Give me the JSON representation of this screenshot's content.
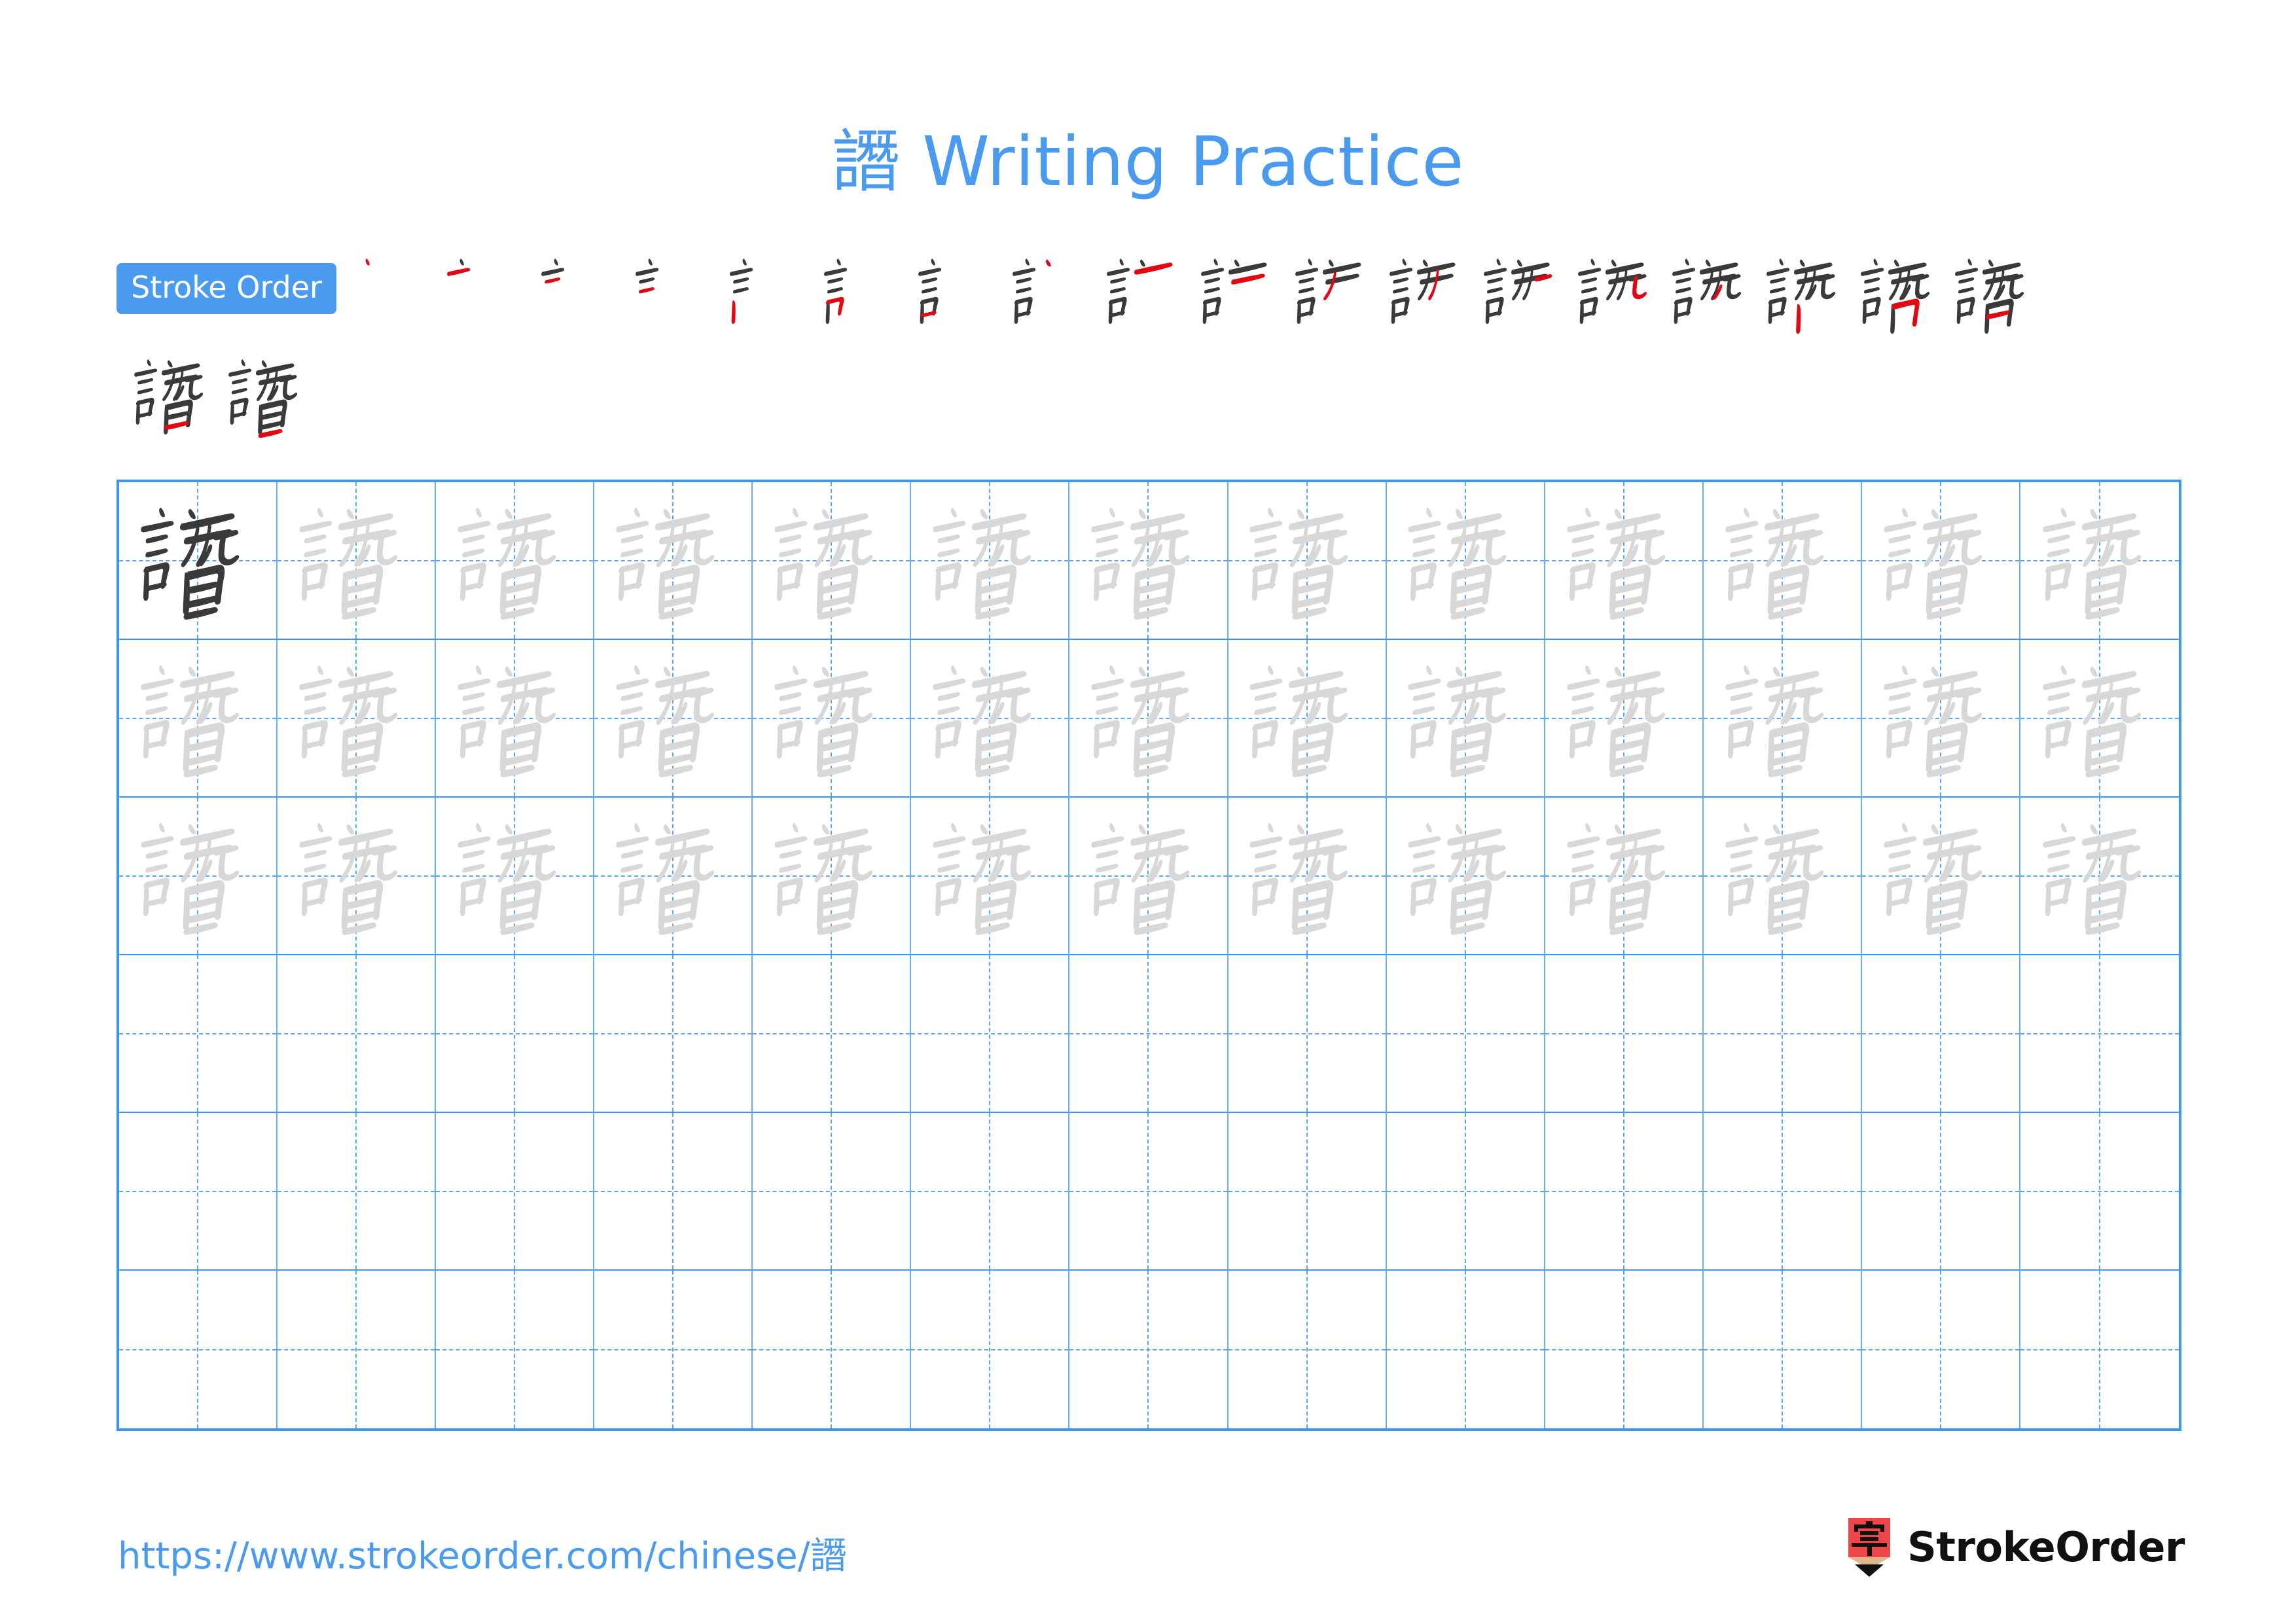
{
  "page": {
    "character": "譖",
    "title_suffix": " Writing Practice",
    "title_full": "譖 Writing Practice",
    "background_color": "#ffffff",
    "accent_color": "#4A9BF0",
    "grid_line_color": "#3E95F0",
    "guide_line_color": "#5AA6F5",
    "faint_glyph_color": "#D8D8D8",
    "dark_glyph_color": "#3A3A3A",
    "highlight_stroke_color": "#E30613"
  },
  "stroke_order": {
    "badge_label": "Stroke Order",
    "total_strokes": 20,
    "row_1_count": 18,
    "row_2_count": 2,
    "description": "Progressive stroke-by-stroke build-up of 譖; the newest stroke in each step is drawn in red."
  },
  "grid": {
    "columns": 13,
    "rows": 6,
    "filled_rows": 3,
    "empty_rows": 3,
    "traced_character": "譖",
    "first_cell_style": "dark",
    "other_cell_style": "faint"
  },
  "footer": {
    "url": "https://www.strokeorder.com/chinese/譖",
    "brand_name": "StrokeOrder",
    "brand_mark_character": "字",
    "brand_mark_color": "#F0484A",
    "brand_mark_wood_color": "#DDB78E"
  }
}
